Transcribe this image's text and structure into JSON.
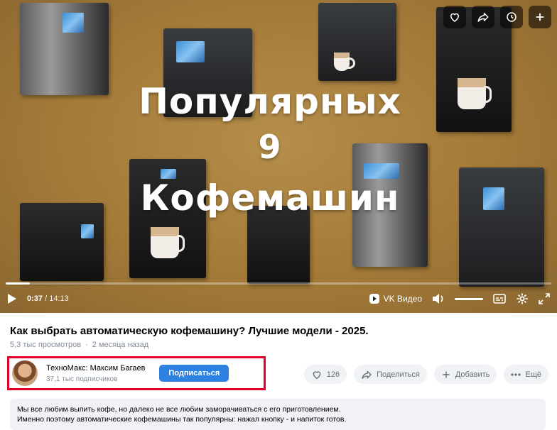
{
  "video": {
    "overlay_line1": "Популярных",
    "overlay_line2": "9",
    "overlay_line3": "Кофемашин",
    "progress": 0.044,
    "current_time": "0:37",
    "duration": "14:13",
    "time_separator": "/",
    "brand": "VK Видео"
  },
  "title": "Как выбрать автоматическую кофемашину? Лучшие модели - 2025.",
  "meta": {
    "views": "5,3 тыс просмотров",
    "dot": "·",
    "age": "2 месяца назад"
  },
  "channel": {
    "name": "ТехноМакс: Максим Багаев",
    "subscribers": "37,1 тыс подписчиков",
    "subscribe_label": "Подписаться",
    "highlight_color": "#e3002b"
  },
  "actions": {
    "likes": "126",
    "share_label": "Поделиться",
    "add_label": "Добавить",
    "more_label": "Ещё"
  },
  "description": {
    "line1": "Мы все любим выпить кофе, но далеко не все любим заморачиваться с его приготовлением.",
    "line2": "Именно поэтому автоматические кофемашины так популярны: нажал кнопку - и напиток готов."
  },
  "icons": [
    "heart-icon",
    "share-icon",
    "clock-icon",
    "plus-icon",
    "play-icon",
    "volume-icon",
    "subtitles-icon",
    "gear-icon",
    "fullscreen-icon",
    "more-icon"
  ]
}
